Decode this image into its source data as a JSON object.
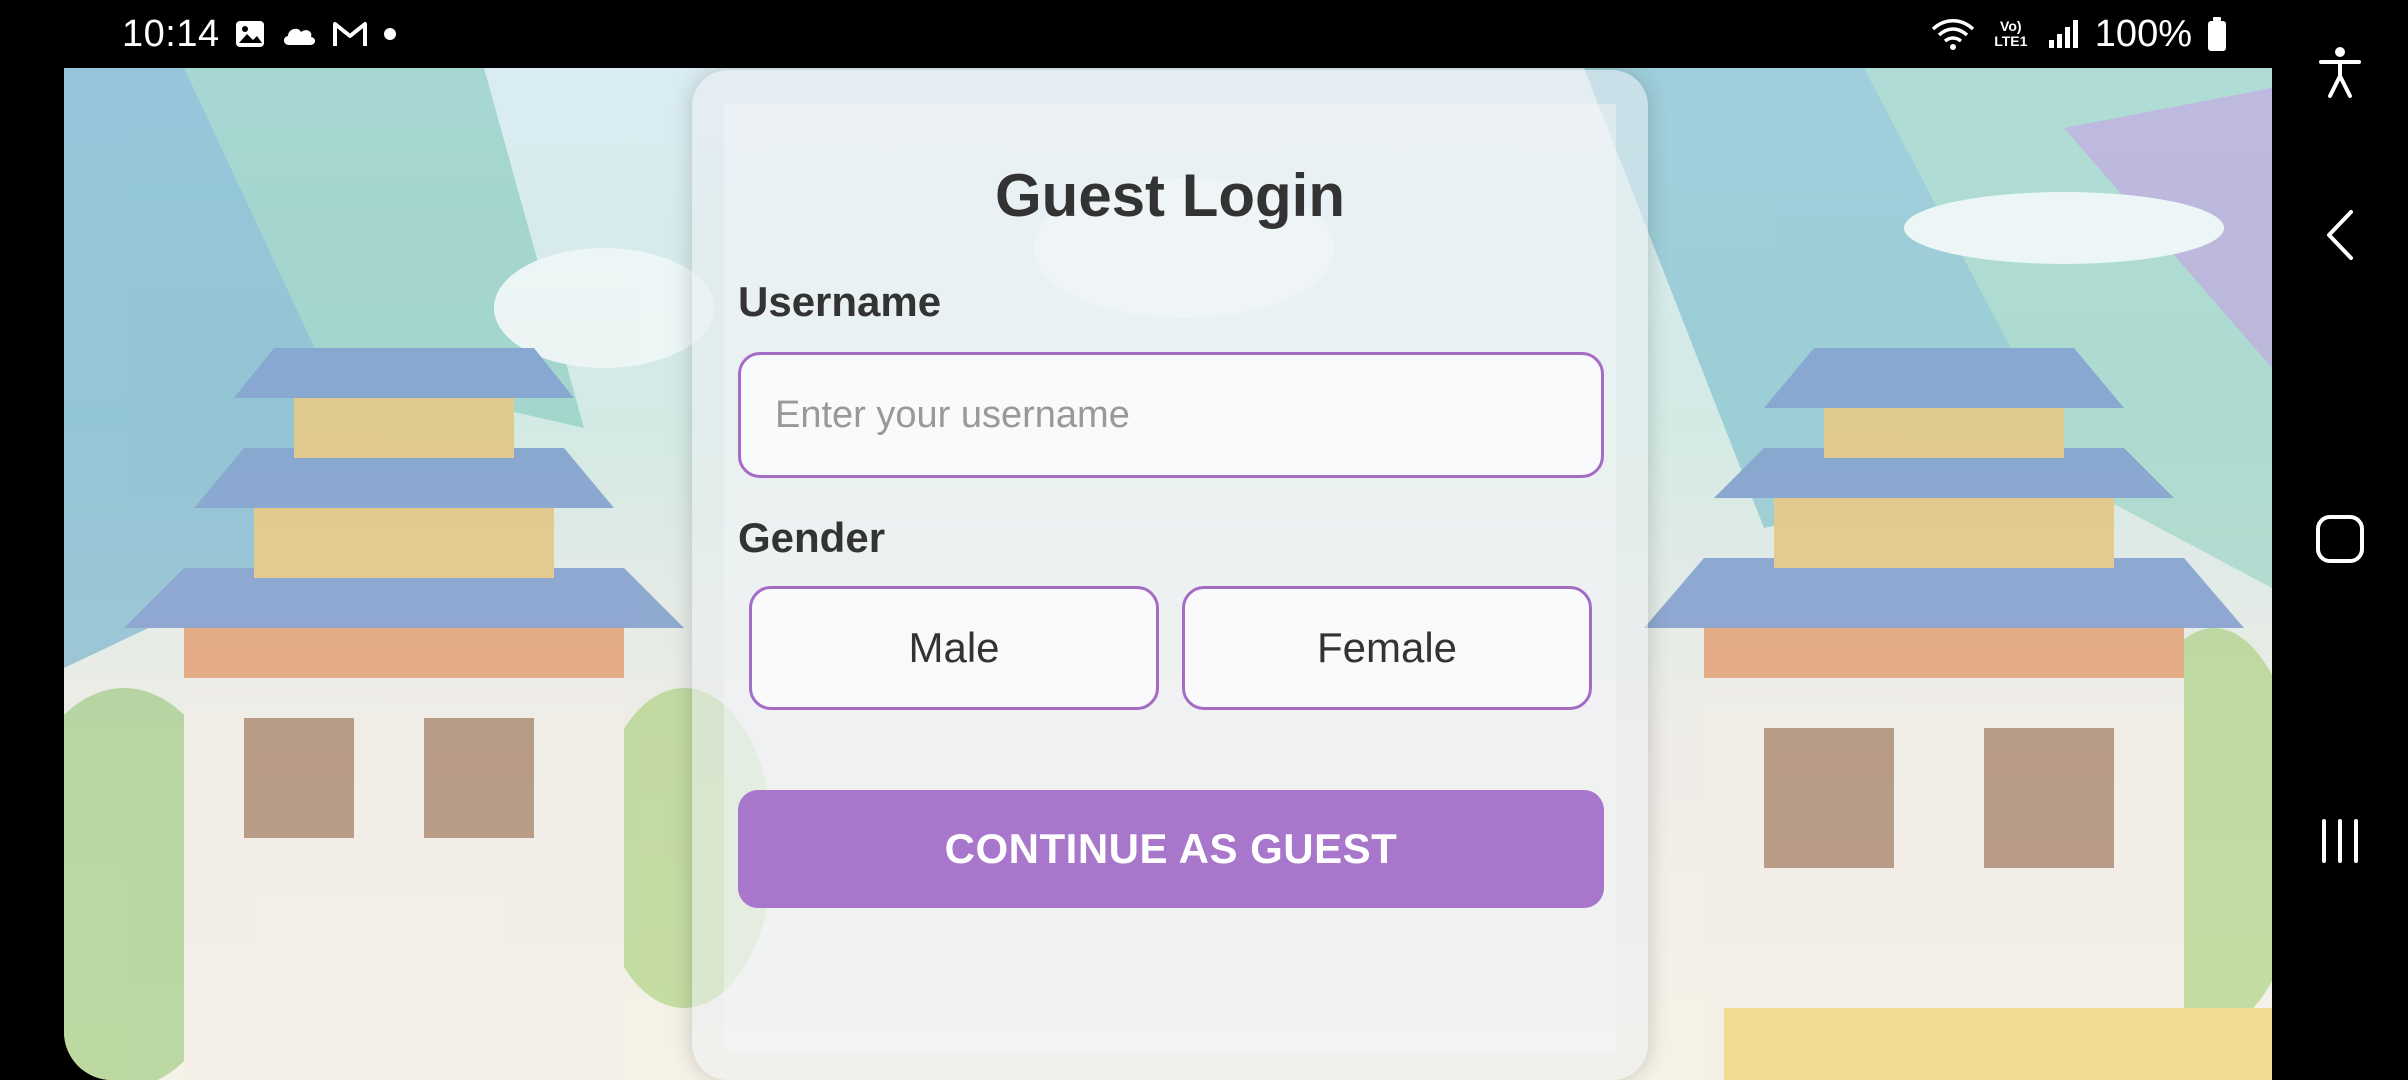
{
  "status_bar": {
    "time": "10:14",
    "left_icons": [
      "gallery-icon",
      "cloud-icon",
      "gmail-icon",
      "dot-icon"
    ],
    "right_icons": [
      "wifi-icon",
      "volte-icon",
      "signal-icon",
      "battery-icon"
    ],
    "volte_label": "Vo) LTE1",
    "battery": "100%"
  },
  "login": {
    "title": "Guest Login",
    "username_label": "Username",
    "username_placeholder": "Enter your username",
    "username_value": "",
    "gender_label": "Gender",
    "gender_options": [
      "Male",
      "Female"
    ],
    "continue_label": "CONTINUE AS GUEST"
  },
  "nav_bar": {
    "buttons": [
      "accessibility-icon",
      "back-icon",
      "home-icon",
      "recents-icon"
    ]
  },
  "colors": {
    "accent": "#a877cc",
    "input_border": "#a56cc6",
    "text": "#333333"
  }
}
